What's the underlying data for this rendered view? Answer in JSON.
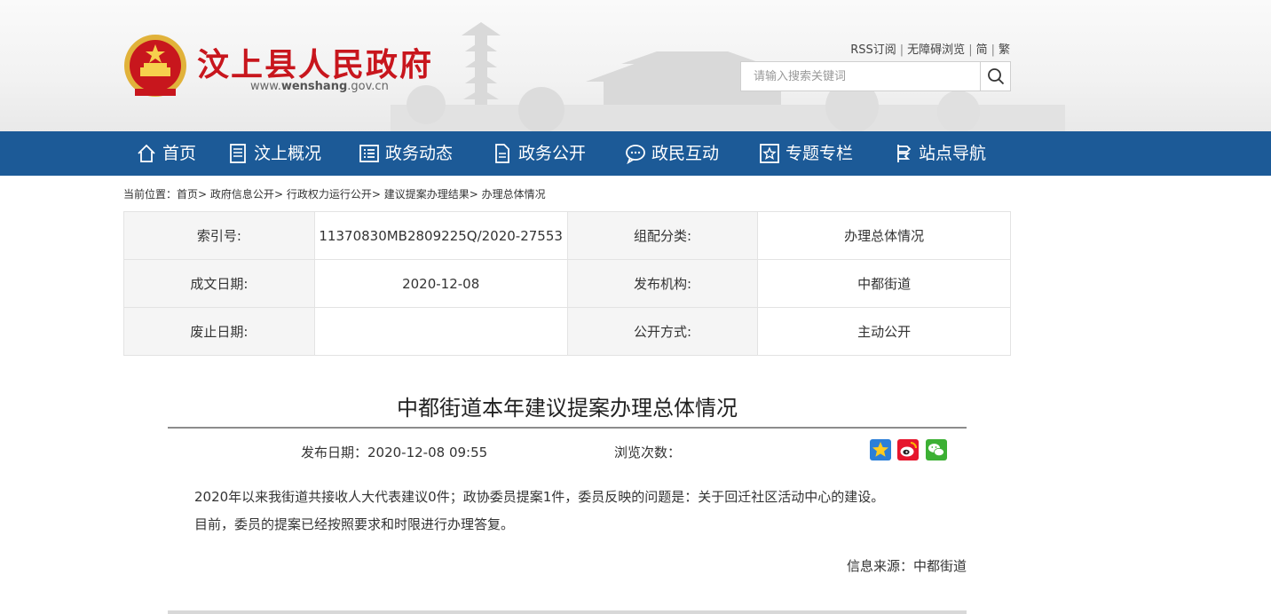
{
  "header": {
    "site_title": "汶上县人民政府",
    "url_prefix": "www.",
    "url_domain": "wenshang",
    "url_suffix": ".gov.cn",
    "top_links": [
      "RSS订阅",
      "无障碍浏览",
      "简",
      "繁"
    ],
    "search_placeholder": "请输入搜索关键词"
  },
  "nav": {
    "items": [
      {
        "label": "首页",
        "icon": "home-icon"
      },
      {
        "label": "汶上概况",
        "icon": "document-icon"
      },
      {
        "label": "政务动态",
        "icon": "list-icon"
      },
      {
        "label": "政务公开",
        "icon": "file-icon"
      },
      {
        "label": "政民互动",
        "icon": "chat-icon"
      },
      {
        "label": "专题专栏",
        "icon": "star-box-icon"
      },
      {
        "label": "站点导航",
        "icon": "signpost-icon"
      }
    ]
  },
  "breadcrumb": {
    "prefix": "当前位置：",
    "items": [
      "首页",
      "政府信息公开",
      "行政权力运行公开",
      "建议提案办理结果",
      "办理总体情况"
    ],
    "separator": ">"
  },
  "info": {
    "index_label": "索引号:",
    "index_value": "11370830MB2809225Q/2020-27553",
    "category_label": "组配分类:",
    "category_value": "办理总体情况",
    "created_label": "成文日期:",
    "created_value": "2020-12-08",
    "publisher_label": "发布机构:",
    "publisher_value": "中都街道",
    "expiry_label": "废止日期:",
    "expiry_value": "",
    "method_label": "公开方式:",
    "method_value": "主动公开"
  },
  "article": {
    "title": "中都街道本年建议提案办理总体情况",
    "pub_date": "发布日期：2020-12-08 09:55",
    "views": "浏览次数：",
    "paragraphs": [
      "2020年以来我街道共接收人大代表建议0件；政协委员提案1件，委员反映的问题是：关于回迁社区活动中心的建设。",
      "目前，委员的提案已经按照要求和时限进行办理答复。"
    ],
    "source": "信息来源：中都街道"
  },
  "colors": {
    "nav_bg": "#1c5a97",
    "title_red": "#c8161d"
  }
}
